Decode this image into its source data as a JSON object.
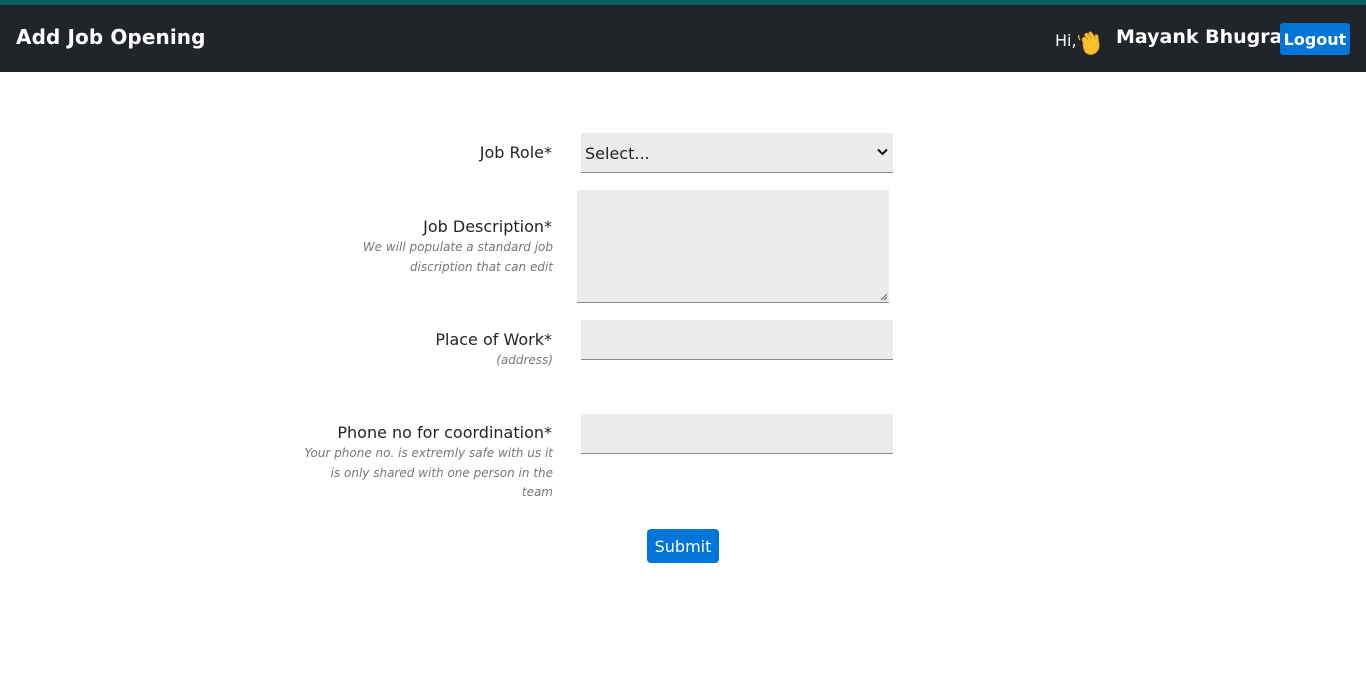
{
  "header": {
    "title": "Add Job Opening",
    "greeting": "Hi,",
    "user_name": "Mayank Bhugra",
    "logout_label": "Logout",
    "wave_icon": "waving-hand-icon"
  },
  "form": {
    "job_role": {
      "label": "Job Role*",
      "selected": "Select..."
    },
    "job_description": {
      "label": "Job Description*",
      "hint_line1": "We will populate a standard job",
      "hint_line2": "discription that can edit",
      "value": ""
    },
    "place_of_work": {
      "label": "Place of Work*",
      "hint": "(address)",
      "value": ""
    },
    "phone": {
      "label": "Phone no for coordination*",
      "hint_line1": "Your phone no. is extremly safe with us it",
      "hint_line2": "is only shared with one person in the",
      "hint_line3": "team",
      "value": ""
    },
    "submit_label": "Submit"
  },
  "colors": {
    "navbar": "#212529",
    "accent": "#0275d8",
    "field_bg": "#ebebeb"
  }
}
